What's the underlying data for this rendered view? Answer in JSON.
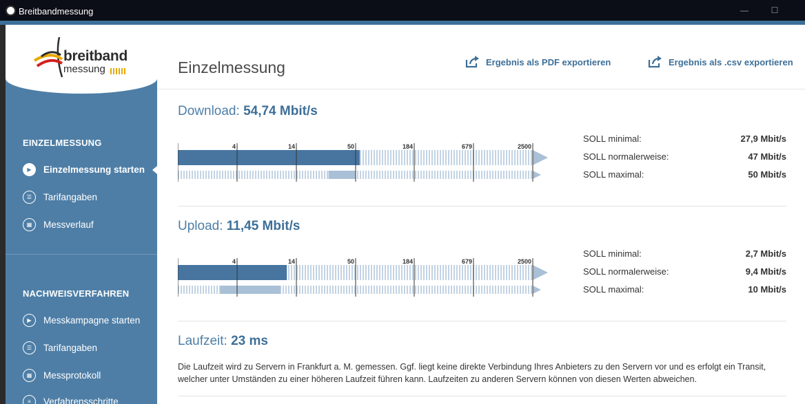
{
  "window": {
    "title": "Breitbandmessung",
    "minimize": "—",
    "maximize": "☐"
  },
  "logo": {
    "word1": "breitband",
    "word2": "messung"
  },
  "sidebar": {
    "section1": "EINZELMESSUNG",
    "items1": [
      {
        "label": "Einzelmessung starten",
        "icon": "play-icon",
        "active": true
      },
      {
        "label": "Tarifangaben",
        "icon": "user-card-icon"
      },
      {
        "label": "Messverlauf",
        "icon": "calendar-icon"
      }
    ],
    "section2": "NACHWEISVERFAHREN",
    "items2": [
      {
        "label": "Messkampagne starten",
        "icon": "play-icon"
      },
      {
        "label": "Tarifangaben",
        "icon": "user-card-icon"
      },
      {
        "label": "Messprotokoll",
        "icon": "calendar-icon"
      },
      {
        "label": "Verfahrensschritte",
        "icon": "list-icon"
      }
    ]
  },
  "header": {
    "title": "Einzelmessung",
    "export_pdf": "Ergebnis als PDF exportieren",
    "export_csv": "Ergebnis als .csv exportieren"
  },
  "scale_ticks": [
    "4",
    "14",
    "50",
    "184",
    "679",
    "2500"
  ],
  "download": {
    "label": "Download:",
    "value": "54,74 Mbit/s",
    "measured_mbit": 54.74,
    "soll_min_label": "SOLL minimal:",
    "soll_min": "27,9 Mbit/s",
    "soll_norm_label": "SOLL normalerweise:",
    "soll_norm": "47 Mbit/s",
    "soll_max_label": "SOLL maximal:",
    "soll_max": "50 Mbit/s",
    "range_min": 27.9,
    "range_max": 50
  },
  "upload": {
    "label": "Upload:",
    "value": "11,45 Mbit/s",
    "measured_mbit": 11.45,
    "soll_min_label": "SOLL minimal:",
    "soll_min": "2,7 Mbit/s",
    "soll_norm_label": "SOLL normalerweise:",
    "soll_norm": "9,4 Mbit/s",
    "soll_max_label": "SOLL maximal:",
    "soll_max": "10 Mbit/s",
    "range_min": 2.7,
    "range_max": 10
  },
  "latency": {
    "label": "Laufzeit:",
    "value": "23 ms",
    "text": "Die Laufzeit wird zu Servern in Frankfurt a. M. gemessen. Ggf. liegt keine direkte Verbindung Ihres Anbieters zu den Servern vor und es erfolgt ein Transit, welcher unter Umständen zu einer höheren Laufzeit führen kann. Laufzeiten zu anderen Servern können von diesen Werten abweichen."
  },
  "colors": {
    "accent": "#3d6f98",
    "sidebar": "#4e7ea6",
    "bar_light": "#a9c0d6"
  }
}
